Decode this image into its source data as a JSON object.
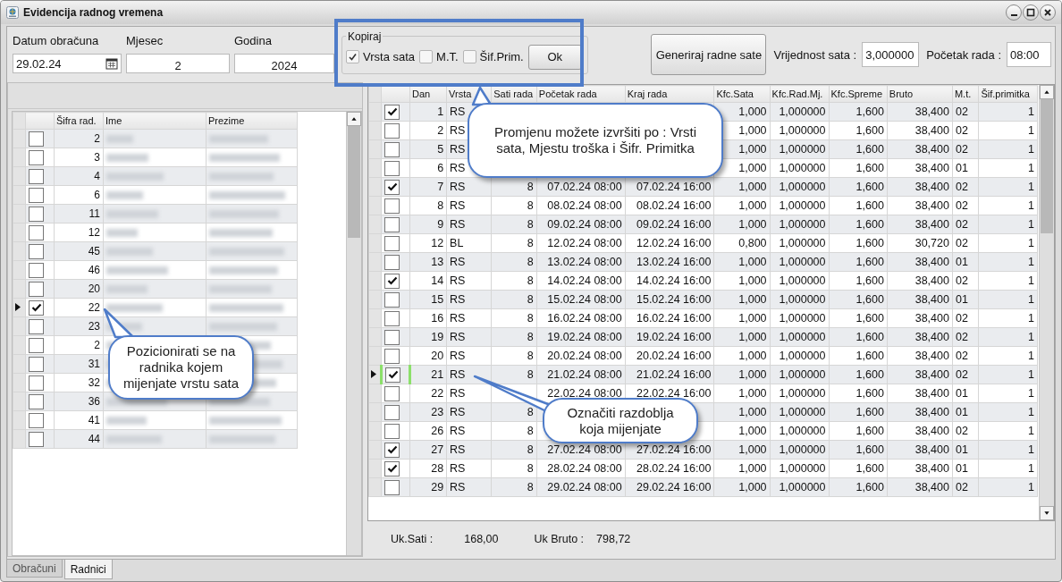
{
  "window": {
    "title": "Evidencija radnog vremena"
  },
  "header": {
    "fields": [
      {
        "label": "Datum obračuna",
        "value": "29.02.24",
        "kind": "date"
      },
      {
        "label": "Mjesec",
        "value": "2",
        "kind": "number"
      },
      {
        "label": "Godina",
        "value": "2024",
        "kind": "number"
      }
    ],
    "copy_group": {
      "title": "Kopiraj",
      "options": [
        {
          "label": "Vrsta sata",
          "checked": true
        },
        {
          "label": "M.T.",
          "checked": false
        },
        {
          "label": "Šif.Prim.",
          "checked": false
        }
      ],
      "button": "Ok"
    },
    "generate_button": "Generiraj radne sate",
    "hour_value": {
      "label": "Vrijednost sata :",
      "value": "3,000000"
    },
    "work_start": {
      "label": "Početak rada :",
      "value": "08:00"
    }
  },
  "workers": {
    "columns": [
      "Šifra rad.",
      "Ime",
      "Prezime"
    ],
    "rows": [
      {
        "sifra": "2",
        "checked": false,
        "current": false
      },
      {
        "sifra": "3",
        "checked": false,
        "current": false
      },
      {
        "sifra": "4",
        "checked": false,
        "current": false
      },
      {
        "sifra": "6",
        "checked": false,
        "current": false
      },
      {
        "sifra": "11",
        "checked": false,
        "current": false
      },
      {
        "sifra": "12",
        "checked": false,
        "current": false
      },
      {
        "sifra": "45",
        "checked": false,
        "current": false
      },
      {
        "sifra": "46",
        "checked": false,
        "current": false
      },
      {
        "sifra": "20",
        "checked": false,
        "current": false
      },
      {
        "sifra": "22",
        "checked": true,
        "current": true
      },
      {
        "sifra": "23",
        "checked": false,
        "current": false
      },
      {
        "sifra": "2",
        "checked": false,
        "current": false
      },
      {
        "sifra": "31",
        "checked": false,
        "current": false
      },
      {
        "sifra": "32",
        "checked": false,
        "current": false
      },
      {
        "sifra": "36",
        "checked": false,
        "current": false
      },
      {
        "sifra": "41",
        "checked": false,
        "current": false
      },
      {
        "sifra": "44",
        "checked": false,
        "current": false
      }
    ]
  },
  "days": {
    "columns": [
      "Dan",
      "Vrsta",
      "Sati rada",
      "Početak rada",
      "Kraj rada",
      "Kfc.Sata",
      "Kfc.Rad.Mj.",
      "Kfc.Spreme",
      "Bruto",
      "M.t.",
      "Šif.primitka"
    ],
    "rows": [
      {
        "dan": "1",
        "vrsta": "RS",
        "kfc_sata": "1,000",
        "kfc_rad_mj": "1,000000",
        "kfc_spreme": "1,600",
        "bruto": "38,400",
        "mt": "02",
        "sif": "1",
        "checked": true,
        "current": false
      },
      {
        "dan": "2",
        "vrsta": "RS",
        "kfc_sata": "1,000",
        "kfc_rad_mj": "1,000000",
        "kfc_spreme": "1,600",
        "bruto": "38,400",
        "mt": "02",
        "sif": "1",
        "checked": false,
        "current": false
      },
      {
        "dan": "5",
        "vrsta": "RS",
        "kfc_sata": "1,000",
        "kfc_rad_mj": "1,000000",
        "kfc_spreme": "1,600",
        "bruto": "38,400",
        "mt": "02",
        "sif": "1",
        "checked": false,
        "current": false
      },
      {
        "dan": "6",
        "vrsta": "RS",
        "kfc_sata": "1,000",
        "kfc_rad_mj": "1,000000",
        "kfc_spreme": "1,600",
        "bruto": "38,400",
        "mt": "01",
        "sif": "1",
        "checked": false,
        "current": false
      },
      {
        "dan": "7",
        "vrsta": "RS",
        "sati": "8",
        "pocetak": "07.02.24 08:00",
        "kraj": "07.02.24 16:00",
        "kfc_sata": "1,000",
        "kfc_rad_mj": "1,000000",
        "kfc_spreme": "1,600",
        "bruto": "38,400",
        "mt": "02",
        "sif": "1",
        "checked": true,
        "current": false
      },
      {
        "dan": "8",
        "vrsta": "RS",
        "sati": "8",
        "pocetak": "08.02.24 08:00",
        "kraj": "08.02.24 16:00",
        "kfc_sata": "1,000",
        "kfc_rad_mj": "1,000000",
        "kfc_spreme": "1,600",
        "bruto": "38,400",
        "mt": "02",
        "sif": "1",
        "checked": false,
        "current": false
      },
      {
        "dan": "9",
        "vrsta": "RS",
        "sati": "8",
        "pocetak": "09.02.24 08:00",
        "kraj": "09.02.24 16:00",
        "kfc_sata": "1,000",
        "kfc_rad_mj": "1,000000",
        "kfc_spreme": "1,600",
        "bruto": "38,400",
        "mt": "02",
        "sif": "1",
        "checked": false,
        "current": false
      },
      {
        "dan": "12",
        "vrsta": "BL",
        "sati": "8",
        "pocetak": "12.02.24 08:00",
        "kraj": "12.02.24 16:00",
        "kfc_sata": "0,800",
        "kfc_rad_mj": "1,000000",
        "kfc_spreme": "1,600",
        "bruto": "30,720",
        "mt": "02",
        "sif": "1",
        "checked": false,
        "current": false
      },
      {
        "dan": "13",
        "vrsta": "RS",
        "sati": "8",
        "pocetak": "13.02.24 08:00",
        "kraj": "13.02.24 16:00",
        "kfc_sata": "1,000",
        "kfc_rad_mj": "1,000000",
        "kfc_spreme": "1,600",
        "bruto": "38,400",
        "mt": "01",
        "sif": "1",
        "checked": false,
        "current": false
      },
      {
        "dan": "14",
        "vrsta": "RS",
        "sati": "8",
        "pocetak": "14.02.24 08:00",
        "kraj": "14.02.24 16:00",
        "kfc_sata": "1,000",
        "kfc_rad_mj": "1,000000",
        "kfc_spreme": "1,600",
        "bruto": "38,400",
        "mt": "02",
        "sif": "1",
        "checked": true,
        "current": false
      },
      {
        "dan": "15",
        "vrsta": "RS",
        "sati": "8",
        "pocetak": "15.02.24 08:00",
        "kraj": "15.02.24 16:00",
        "kfc_sata": "1,000",
        "kfc_rad_mj": "1,000000",
        "kfc_spreme": "1,600",
        "bruto": "38,400",
        "mt": "01",
        "sif": "1",
        "checked": false,
        "current": false
      },
      {
        "dan": "16",
        "vrsta": "RS",
        "sati": "8",
        "pocetak": "16.02.24 08:00",
        "kraj": "16.02.24 16:00",
        "kfc_sata": "1,000",
        "kfc_rad_mj": "1,000000",
        "kfc_spreme": "1,600",
        "bruto": "38,400",
        "mt": "02",
        "sif": "1",
        "checked": false,
        "current": false
      },
      {
        "dan": "19",
        "vrsta": "RS",
        "sati": "8",
        "pocetak": "19.02.24 08:00",
        "kraj": "19.02.24 16:00",
        "kfc_sata": "1,000",
        "kfc_rad_mj": "1,000000",
        "kfc_spreme": "1,600",
        "bruto": "38,400",
        "mt": "02",
        "sif": "1",
        "checked": false,
        "current": false
      },
      {
        "dan": "20",
        "vrsta": "RS",
        "sati": "8",
        "pocetak": "20.02.24 08:00",
        "kraj": "20.02.24 16:00",
        "kfc_sata": "1,000",
        "kfc_rad_mj": "1,000000",
        "kfc_spreme": "1,600",
        "bruto": "38,400",
        "mt": "02",
        "sif": "1",
        "checked": false,
        "current": false
      },
      {
        "dan": "21",
        "vrsta": "RS",
        "sati": "8",
        "pocetak": "21.02.24 08:00",
        "kraj": "21.02.24 16:00",
        "kfc_sata": "1,000",
        "kfc_rad_mj": "1,000000",
        "kfc_spreme": "1,600",
        "bruto": "38,400",
        "mt": "02",
        "sif": "1",
        "checked": true,
        "current": true
      },
      {
        "dan": "22",
        "vrsta": "RS",
        "pocetak": "22.02.24 08:00",
        "kraj": "22.02.24 16:00",
        "kfc_sata": "1,000",
        "kfc_rad_mj": "1,000000",
        "kfc_spreme": "1,600",
        "bruto": "38,400",
        "mt": "01",
        "sif": "1",
        "checked": false,
        "current": false
      },
      {
        "dan": "23",
        "vrsta": "RS",
        "sati": "8",
        "kfc_sata": "1,000",
        "kfc_rad_mj": "1,000000",
        "kfc_spreme": "1,600",
        "bruto": "38,400",
        "mt": "01",
        "sif": "1",
        "checked": false,
        "current": false
      },
      {
        "dan": "26",
        "vrsta": "RS",
        "sati": "8",
        "kfc_sata": "1,000",
        "kfc_rad_mj": "1,000000",
        "kfc_spreme": "1,600",
        "bruto": "38,400",
        "mt": "02",
        "sif": "1",
        "checked": false,
        "current": false
      },
      {
        "dan": "27",
        "vrsta": "RS",
        "sati": "8",
        "pocetak": "27.02.24 08:00",
        "kraj": "27.02.24 16:00",
        "kfc_sata": "1,000",
        "kfc_rad_mj": "1,000000",
        "kfc_spreme": "1,600",
        "bruto": "38,400",
        "mt": "01",
        "sif": "1",
        "checked": true,
        "current": false
      },
      {
        "dan": "28",
        "vrsta": "RS",
        "sati": "8",
        "pocetak": "28.02.24 08:00",
        "kraj": "28.02.24 16:00",
        "kfc_sata": "1,000",
        "kfc_rad_mj": "1,000000",
        "kfc_spreme": "1,600",
        "bruto": "38,400",
        "mt": "01",
        "sif": "1",
        "checked": true,
        "current": false
      },
      {
        "dan": "29",
        "vrsta": "RS",
        "sati": "8",
        "pocetak": "29.02.24 08:00",
        "kraj": "29.02.24 16:00",
        "kfc_sata": "1,000",
        "kfc_rad_mj": "1,000000",
        "kfc_spreme": "1,600",
        "bruto": "38,400",
        "mt": "02",
        "sif": "1",
        "checked": false,
        "current": false
      }
    ]
  },
  "totals": [
    {
      "label": "Uk.Sati :",
      "value": "168,00"
    },
    {
      "label": "Uk Bruto :",
      "value": "798,72"
    }
  ],
  "tabs": [
    {
      "label": "Obračuni",
      "selected": false
    },
    {
      "label": "Radnici",
      "selected": true
    }
  ],
  "callouts": [
    {
      "kind": "copy",
      "text": "Promjenu možete izvršiti po : Vrsti sata, Mjestu troška i Šifr. Primitka"
    },
    {
      "kind": "worker",
      "text": "Pozicionirati se na radnika kojem mijenjate vrstu sata"
    },
    {
      "kind": "days",
      "text": "Označiti razdoblja koja mijenjate"
    }
  ]
}
